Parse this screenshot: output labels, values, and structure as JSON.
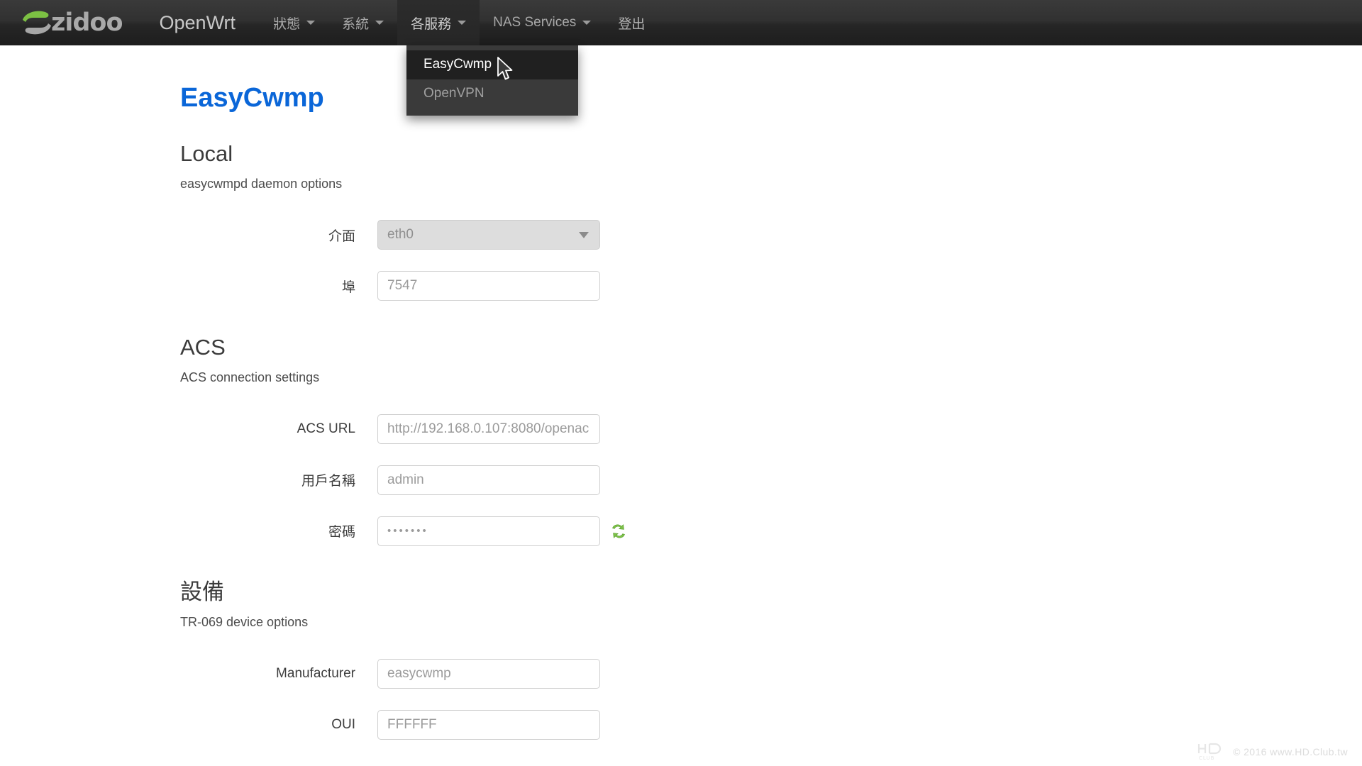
{
  "navbar": {
    "logo_word": "zidoo",
    "logo_icon": "zidoo-swoosh-logo",
    "brand_title": "OpenWrt",
    "items": [
      {
        "label": "狀態",
        "has_caret": true,
        "state": "normal"
      },
      {
        "label": "系統",
        "has_caret": true,
        "state": "normal"
      },
      {
        "label": "各服務",
        "has_caret": true,
        "state": "open"
      },
      {
        "label": "NAS Services",
        "has_caret": true,
        "state": "normal"
      },
      {
        "label": "登出",
        "has_caret": false,
        "state": "normal"
      }
    ]
  },
  "dropdown": {
    "open_for": "各服務",
    "items": [
      {
        "label": "EasyCwmp",
        "active": true
      },
      {
        "label": "OpenVPN",
        "active": false
      }
    ]
  },
  "page": {
    "title": "EasyCwmp"
  },
  "sections": [
    {
      "heading": "Local",
      "desc": "easycwmpd daemon options",
      "fields": [
        {
          "label": "介面",
          "value": "eth0",
          "type": "select",
          "icon": "chevron-down-icon"
        },
        {
          "label": "埠",
          "value": "7547",
          "type": "text"
        }
      ]
    },
    {
      "heading": "ACS",
      "desc": "ACS connection settings",
      "fields": [
        {
          "label": "ACS URL",
          "value": "http://192.168.0.107:8080/openac",
          "type": "text"
        },
        {
          "label": "用戶名稱",
          "value": "admin",
          "type": "text"
        },
        {
          "label": "密碼",
          "value": "•••••••",
          "type": "password",
          "icon": "reveal-password-refresh-icon"
        }
      ]
    },
    {
      "heading": "設備",
      "desc": "TR-069 device options",
      "fields": [
        {
          "label": "Manufacturer",
          "value": "easycwmp",
          "type": "text"
        },
        {
          "label": "OUI",
          "value": "FFFFFF",
          "type": "text"
        }
      ]
    }
  ],
  "watermark": {
    "logo": "hd-club-logo",
    "text": "© 2016  www.HD.Club.tw"
  },
  "colors": {
    "accent_blue": "#0a66d8",
    "logo_green": "#7cc043",
    "navbar_dark": "#2d2d2d",
    "dropdown_bg": "#3a3a3a",
    "dropdown_active_bg": "#202020",
    "refresh_icon_green": "#74bd44"
  }
}
